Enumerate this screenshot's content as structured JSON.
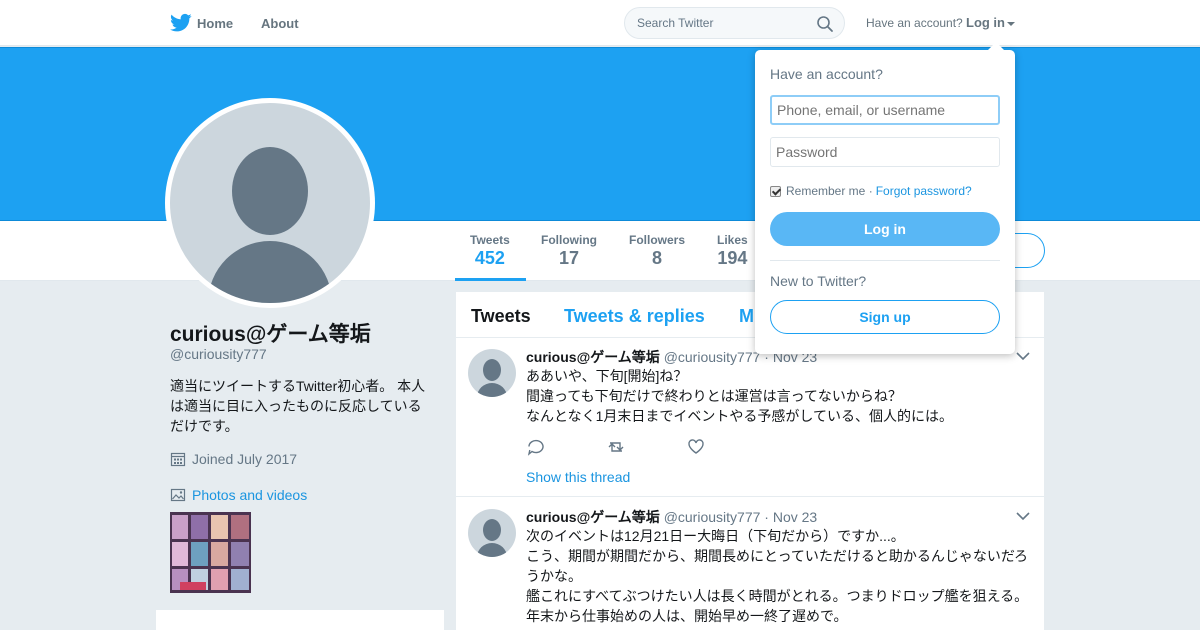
{
  "nav": {
    "home_label": "Home",
    "about_label": "About",
    "search_placeholder": "Search Twitter",
    "have_account": "Have an account?",
    "login_label": "Log in"
  },
  "profile": {
    "name": "curious@ゲーム等垢",
    "handle": "@curiousity777",
    "bio": "適当にツイートするTwitter初心者。 本人は適当に目に入ったものに反応しているだけです。",
    "joined": "Joined July 2017",
    "photos_label": "Photos and videos"
  },
  "stats": [
    {
      "label": "Tweets",
      "value": "452"
    },
    {
      "label": "Following",
      "value": "17"
    },
    {
      "label": "Followers",
      "value": "8"
    },
    {
      "label": "Likes",
      "value": "194"
    }
  ],
  "timeline": {
    "tabs": [
      "Tweets",
      "Tweets & replies",
      "M"
    ],
    "tweets": [
      {
        "name": "curious@ゲーム等垢",
        "handle": "@curiousity777",
        "date": "Nov 23",
        "lines": [
          "ああいや、下旬[開始]ね？",
          "間違っても下旬だけで終わりとは運営は言ってないからね？",
          "なんとなく1月末日までイベントやる予感がしている、個人的には。"
        ],
        "thread_label": "Show this thread"
      },
      {
        "name": "curious@ゲーム等垢",
        "handle": "@curiousity777",
        "date": "Nov 23",
        "lines": [
          "次のイベントは12月21日ー大晦日（下旬だから）ですか...。",
          "こう、期間が期間だから、期間長めにとっていただけると助かるんじゃないだろ",
          "うかな。",
          "艦これにすべてぶつけたい人は長く時間がとれる。つまりドロップ艦を狙える。",
          "年末から仕事始めの人は、開始早め一終了遅めで。"
        ]
      }
    ]
  },
  "login_dropdown": {
    "title": "Have an account?",
    "username_placeholder": "Phone, email, or username",
    "password_placeholder": "Password",
    "remember_label": "Remember me · ",
    "forgot_label": "Forgot password?",
    "login_button": "Log in",
    "new_label": "New to Twitter?",
    "signup_button": "Sign up"
  },
  "colors": {
    "accent": "#1da1f2",
    "banner": "#1da1f2",
    "page_bg": "#e6ecf0"
  }
}
